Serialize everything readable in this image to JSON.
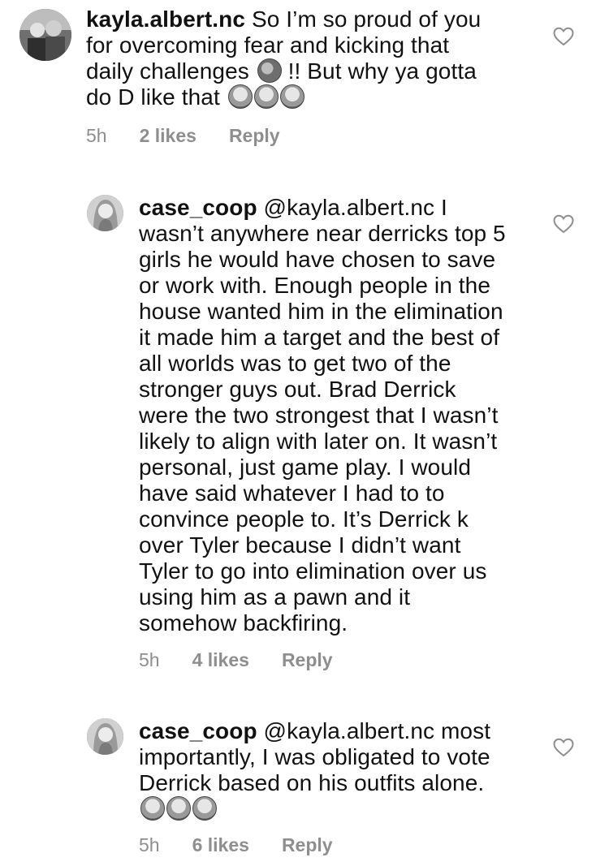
{
  "comments": [
    {
      "username": "kayla.albert.nc",
      "text_lines": [
        "So I’m so proud of you",
        "for overcoming fear and kicking that",
        "daily challenges",
        "!! But why ya gotta",
        "do D like that"
      ],
      "time": "5h",
      "likes": "2 likes",
      "reply": "Reply"
    },
    {
      "username": "case_coop",
      "mention": "@kayla.albert.nc",
      "text_lines": [
        "I",
        "wasn’t anywhere near derricks top 5",
        "girls he would have chosen to save",
        "or work with. Enough people in the",
        "house wanted him in the elimination",
        "it made him a target and the best of",
        "all worlds was to get two of the",
        "stronger guys out. Brad Derrick",
        "were the two strongest that I wasn’t",
        "likely to align with later on. It wasn’t",
        "personal, just game play. I would",
        "have said whatever I had to to",
        "convince people to. It’s Derrick k",
        "over Tyler because I didn’t want",
        "Tyler to go into elimination over us",
        "using him as a pawn and it",
        "somehow backfiring."
      ],
      "time": "5h",
      "likes": "4 likes",
      "reply": "Reply"
    },
    {
      "username": "case_coop",
      "mention": "@kayla.albert.nc",
      "text_lines": [
        "most",
        "importantly, I was obligated to vote",
        "Derrick based on his outfits alone."
      ],
      "time": "5h",
      "likes": "6 likes",
      "reply": "Reply"
    }
  ],
  "icons": {
    "like": "heart-outline-icon",
    "emoji_peach": "peach-emoji-icon",
    "emoji_laugh": "tears-of-joy-emoji-icon",
    "emoji_weary": "weary-face-emoji-icon",
    "emoji_scream": "screaming-face-emoji-icon"
  }
}
